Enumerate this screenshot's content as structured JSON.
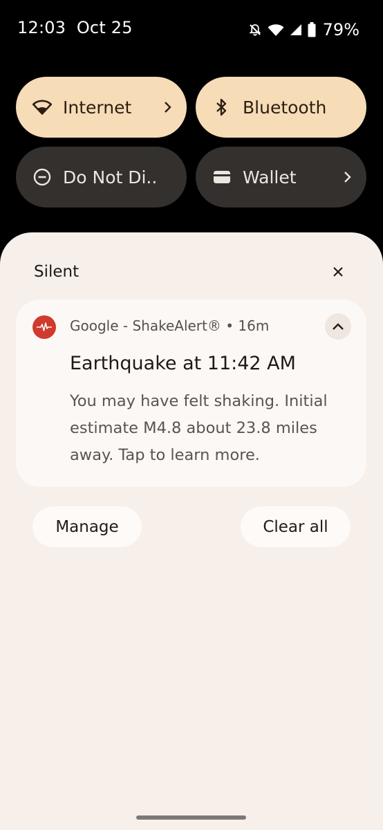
{
  "status_bar": {
    "time": "12:03",
    "date": "Oct 25",
    "battery_percent": "79%",
    "icons": [
      "bell-off-icon",
      "wifi-icon",
      "cellular-signal-icon",
      "battery-icon"
    ]
  },
  "quick_settings": {
    "tiles": [
      {
        "label": "Internet",
        "icon": "wifi-icon",
        "active": true,
        "has_chevron": true
      },
      {
        "label": "Bluetooth",
        "icon": "bluetooth-icon",
        "active": true,
        "has_chevron": false
      },
      {
        "label": "Do Not Di..",
        "icon": "do-not-disturb-icon",
        "active": false,
        "has_chevron": false
      },
      {
        "label": "Wallet",
        "icon": "wallet-icon",
        "active": false,
        "has_chevron": true
      }
    ]
  },
  "notifications": {
    "section_title": "Silent",
    "items": [
      {
        "header": "Google - ShakeAlert® • 16m",
        "title": "Earthquake at 11:42 AM",
        "body": "You may have felt shaking. Initial estimate M4.8 about 23.8 miles away. Tap to learn more.",
        "icon": "earthquake-alert-icon"
      }
    ],
    "manage_label": "Manage",
    "clear_all_label": "Clear all"
  },
  "colors": {
    "active_tile": "#f6dcb7",
    "inactive_tile": "#33302d",
    "shade_background": "#f7efe9",
    "card_background": "#fcf8f5",
    "app_icon": "#cf3b2f"
  }
}
